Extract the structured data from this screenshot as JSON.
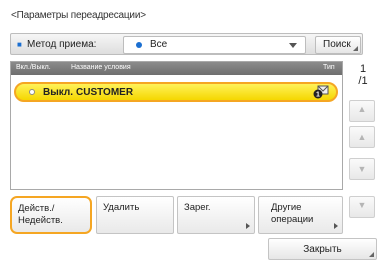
{
  "window": {
    "title": "<Параметры переадресации>"
  },
  "filter": {
    "label": "Метод приема:",
    "selected_value": "Все",
    "search_label": "Поиск"
  },
  "list": {
    "columns": {
      "on_off": "Вкл./Выкл.",
      "name": "Название условия",
      "type": "Тип"
    },
    "rows": [
      {
        "status": "Выкл.",
        "name": "CUSTOMER",
        "selected": true
      }
    ]
  },
  "pager": {
    "current": "1",
    "total": "/1"
  },
  "actions": {
    "activate": "Действ./\nНедейств.",
    "delete": "Удалить",
    "register": "Зарег.",
    "other": "Другие\nоперации"
  },
  "footer": {
    "close_label": "Закрыть"
  },
  "colors": {
    "selection_fill": "#f5d700",
    "selection_border": "#f5a623",
    "accent": "#1b6fd1"
  }
}
